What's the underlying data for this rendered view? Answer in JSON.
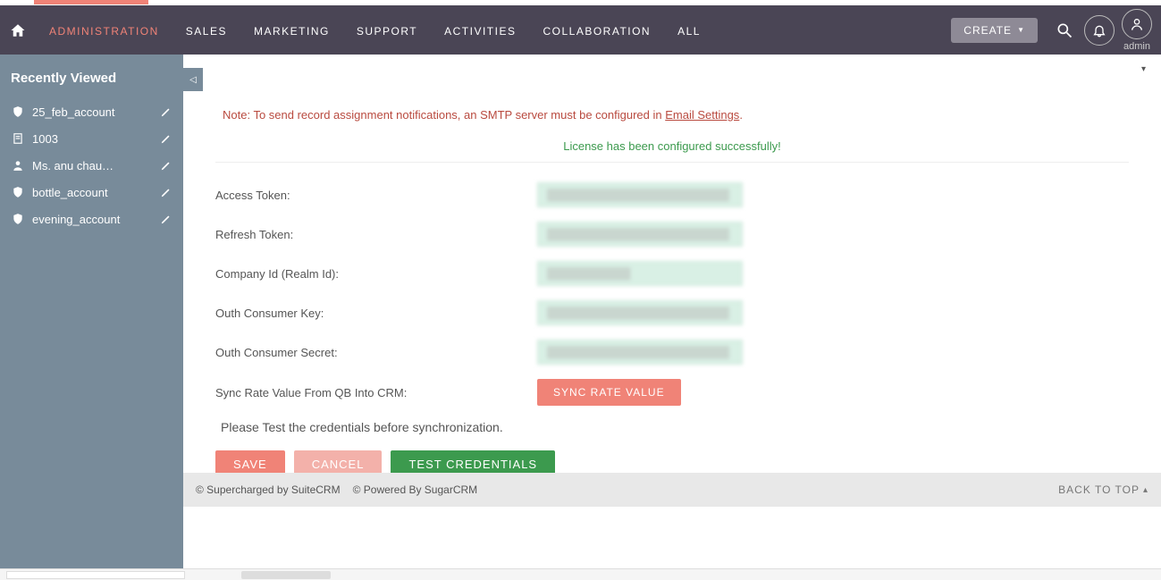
{
  "nav": {
    "items": [
      "ADMINISTRATION",
      "SALES",
      "MARKETING",
      "SUPPORT",
      "ACTIVITIES",
      "COLLABORATION",
      "ALL"
    ],
    "active_index": 0,
    "create_label": "CREATE",
    "user_label": "admin"
  },
  "sidebar": {
    "title": "Recently Viewed",
    "items": [
      {
        "icon": "shield",
        "label": "25_feb_account"
      },
      {
        "icon": "doc",
        "label": "1003"
      },
      {
        "icon": "person",
        "label": "Ms. anu chau…"
      },
      {
        "icon": "shield",
        "label": "bottle_account"
      },
      {
        "icon": "shield",
        "label": "evening_account"
      }
    ]
  },
  "note": {
    "prefix": "Note: To send record assignment notifications, an SMTP server must be configured in ",
    "link": "Email Settings",
    "suffix": "."
  },
  "license_msg": "License has been configured successfully!",
  "form": {
    "fields": [
      {
        "label": "Access Token:",
        "value": "████████████████████████"
      },
      {
        "label": "Refresh Token:",
        "value": "████████████████████████"
      },
      {
        "label": "Company Id (Realm Id):",
        "value": "███████████"
      },
      {
        "label": "Outh Consumer Key:",
        "value": "████████████████████████"
      },
      {
        "label": "Outh Consumer Secret:",
        "value": "████████████████████████"
      }
    ],
    "sync_label": "Sync Rate Value From QB Into CRM:",
    "sync_btn": "SYNC RATE VALUE",
    "test_note": "Please Test the credentials before synchronization."
  },
  "buttons": {
    "save": "SAVE",
    "cancel": "CANCEL",
    "test": "TEST CREDENTIALS"
  },
  "footer": {
    "left1": "© Supercharged by SuiteCRM",
    "left2": "© Powered By SugarCRM",
    "back": "BACK TO TOP"
  }
}
